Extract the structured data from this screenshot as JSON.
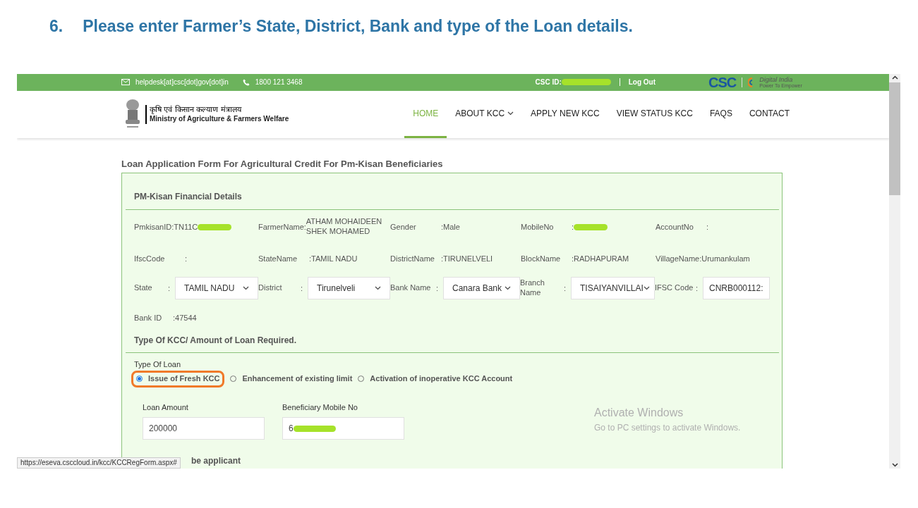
{
  "heading": {
    "number": "6.",
    "text": "Please enter Farmer’s State, District, Bank and type of the Loan details."
  },
  "top_bar": {
    "email": "helpdesk[at]csc[dot]gov[dot]in",
    "phone": "1800 121 3468",
    "csc_id_label": "CSC ID:",
    "logout": "Log Out",
    "csc_logo": "CSC",
    "digital_india": "Digital India",
    "digital_india_tagline": "Power To Empower"
  },
  "ministry": {
    "hindi": "कृषि एवं किसान कल्याण मंत्रालय",
    "english": "Ministry of Agriculture & Farmers Welfare"
  },
  "nav": [
    {
      "label": "HOME",
      "selected": true,
      "dropdown": false
    },
    {
      "label": "ABOUT KCC",
      "selected": false,
      "dropdown": true
    },
    {
      "label": "APPLY NEW KCC",
      "selected": false,
      "dropdown": false
    },
    {
      "label": "VIEW STATUS KCC",
      "selected": false,
      "dropdown": false
    },
    {
      "label": "FAQS",
      "selected": false,
      "dropdown": false
    },
    {
      "label": "CONTACT",
      "selected": false,
      "dropdown": false
    }
  ],
  "form_title": "Loan Application Form For Agricultural Credit For Pm-Kisan Beneficiaries",
  "section1_title": "PM-Kisan Financial Details",
  "info_rows": [
    [
      {
        "label": "PmkisanID:",
        "value": "TN11C",
        "redacted": true
      },
      {
        "label": "FarmerName:",
        "value": "ATHAM MOHAIDEEN SHEK MOHAMED",
        "redacted": false
      },
      {
        "label": "Gender",
        "value": ":Male",
        "redacted": false
      },
      {
        "label": "MobileNo",
        "value": ":",
        "redacted": true
      },
      {
        "label": "AccountNo",
        "value": ":",
        "redacted": false
      }
    ],
    [
      {
        "label": "IfscCode",
        "value": ":",
        "redacted": false
      },
      {
        "label": "StateName",
        "value": ":TAMIL NADU",
        "redacted": false
      },
      {
        "label": "DistrictName",
        "value": ":TIRUNELVELI",
        "redacted": false
      },
      {
        "label": "BlockName",
        "value": ":RADHAPURAM",
        "redacted": false
      },
      {
        "label": "VillageName:",
        "value": "Urumankulam",
        "redacted": false
      }
    ]
  ],
  "selects": [
    {
      "label": "State",
      "colon": ":",
      "value": "TAMIL NADU",
      "kind": "select"
    },
    {
      "label": "District",
      "colon": ":",
      "value": "Tirunelveli",
      "kind": "select"
    },
    {
      "label": "Bank Name",
      "colon": ":",
      "value": "Canara Bank",
      "kind": "select"
    },
    {
      "label": "Branch Name",
      "colon": ":",
      "value": "TISAIYANVILLAI",
      "kind": "select"
    },
    {
      "label": "IFSC Code",
      "colon": ":",
      "value": "CNRB000112:",
      "kind": "input"
    }
  ],
  "bank_id": {
    "label": "Bank ID",
    "value": ":47544"
  },
  "section2_title": "Type Of KCC/ Amount of Loan Required.",
  "loan_type_label": "Type Of Loan",
  "loan_types": [
    {
      "label": "Issue of Fresh KCC",
      "selected": true,
      "highlighted": true
    },
    {
      "label": "Enhancement of existing limit",
      "selected": false,
      "highlighted": false
    },
    {
      "label": "Activation of inoperative KCC Account",
      "selected": false,
      "highlighted": false
    }
  ],
  "loan_amount": {
    "label": "Loan Amount",
    "value": "200000"
  },
  "beneficiary_mobile": {
    "label": "Beneficiary Mobile No",
    "value": "6",
    "redacted": true
  },
  "next_text": "be applicant",
  "status_url": "https://eseva.csccloud.in/kcc/KCCRegForm.aspx#",
  "activation": {
    "title": "Activate Windows",
    "text": "Go to PC settings to activate Windows."
  }
}
